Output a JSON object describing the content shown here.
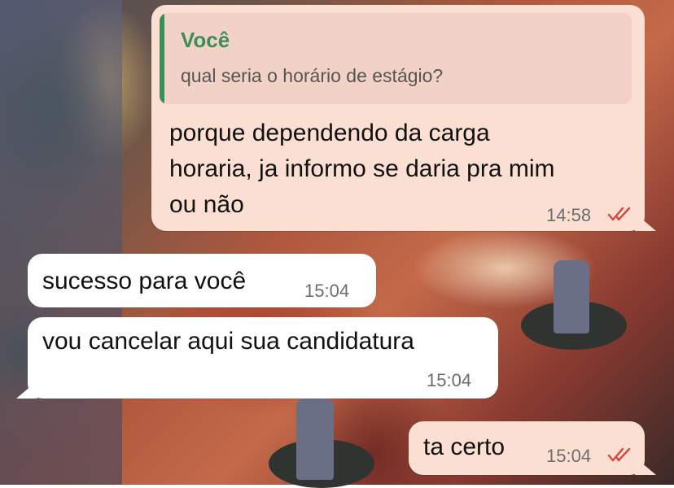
{
  "chat": {
    "messages": [
      {
        "direction": "outgoing",
        "reply_to": {
          "author": "Você",
          "text": "qual seria o horário de estágio?"
        },
        "text_lines": [
          "porque dependendo da carga",
          "horaria, ja informo se daria pra mim",
          "ou não"
        ],
        "time": "14:58",
        "status": "read"
      },
      {
        "direction": "incoming",
        "text": "sucesso para você",
        "time": "15:04"
      },
      {
        "direction": "incoming",
        "text": "vou cancelar aqui sua candidatura",
        "time": "15:04"
      },
      {
        "direction": "outgoing",
        "text": "ta certo",
        "time": "15:04",
        "status": "read"
      }
    ]
  },
  "colors": {
    "outgoing_bubble": "#fbdfd2",
    "incoming_bubble": "#ffffff",
    "quote_accent": "#3d8d5a",
    "read_ticks": "#d9453a"
  },
  "icons": {
    "read_receipt": "double-check-icon"
  }
}
